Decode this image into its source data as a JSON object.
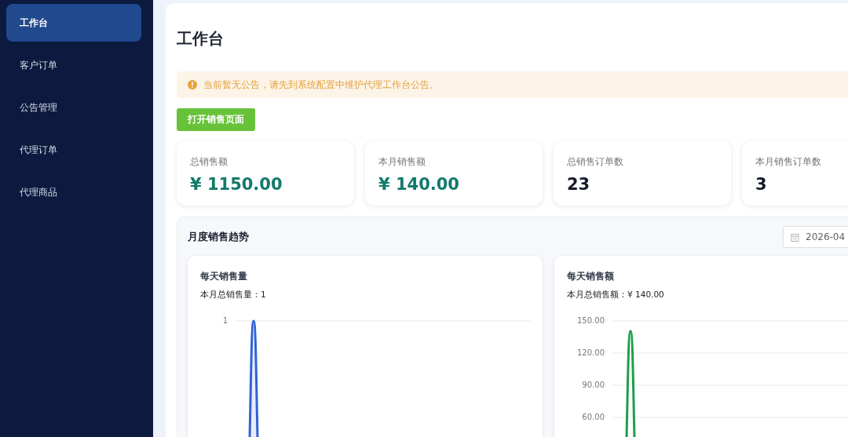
{
  "sidebar": {
    "items": [
      {
        "label": "工作台",
        "selected": true
      },
      {
        "label": "客户订单",
        "selected": false
      },
      {
        "label": "公告管理",
        "selected": false
      },
      {
        "label": "代理订单",
        "selected": false
      },
      {
        "label": "代理商品",
        "selected": false
      }
    ]
  },
  "page": {
    "title": "工作台"
  },
  "notice": {
    "text": "当前暂无公告，请先到系统配置中维护代理工作台公告。"
  },
  "open_button": {
    "label": "打开销售页面"
  },
  "stats": [
    {
      "label": "总销售额",
      "value": "¥ 1150.00",
      "kind": "money"
    },
    {
      "label": "本月销售额",
      "value": "¥ 140.00",
      "kind": "money"
    },
    {
      "label": "总销售订单数",
      "value": "23",
      "kind": "count"
    },
    {
      "label": "本月销售订单数",
      "value": "3",
      "kind": "count"
    }
  ],
  "trend": {
    "title": "月度销售趋势",
    "month_picker": {
      "value": "2026-04"
    },
    "charts": [
      {
        "title": "每天销售量",
        "summary": "本月总销售量：1",
        "color": "#2f63d6",
        "y_tick_labels": [
          "1"
        ]
      },
      {
        "title": "每天销售额",
        "summary": "本月总销售额：¥ 140.00",
        "color": "#1e9e4a",
        "y_tick_labels": [
          "150.00",
          "120.00",
          "90.00",
          "60.00"
        ]
      }
    ]
  }
}
